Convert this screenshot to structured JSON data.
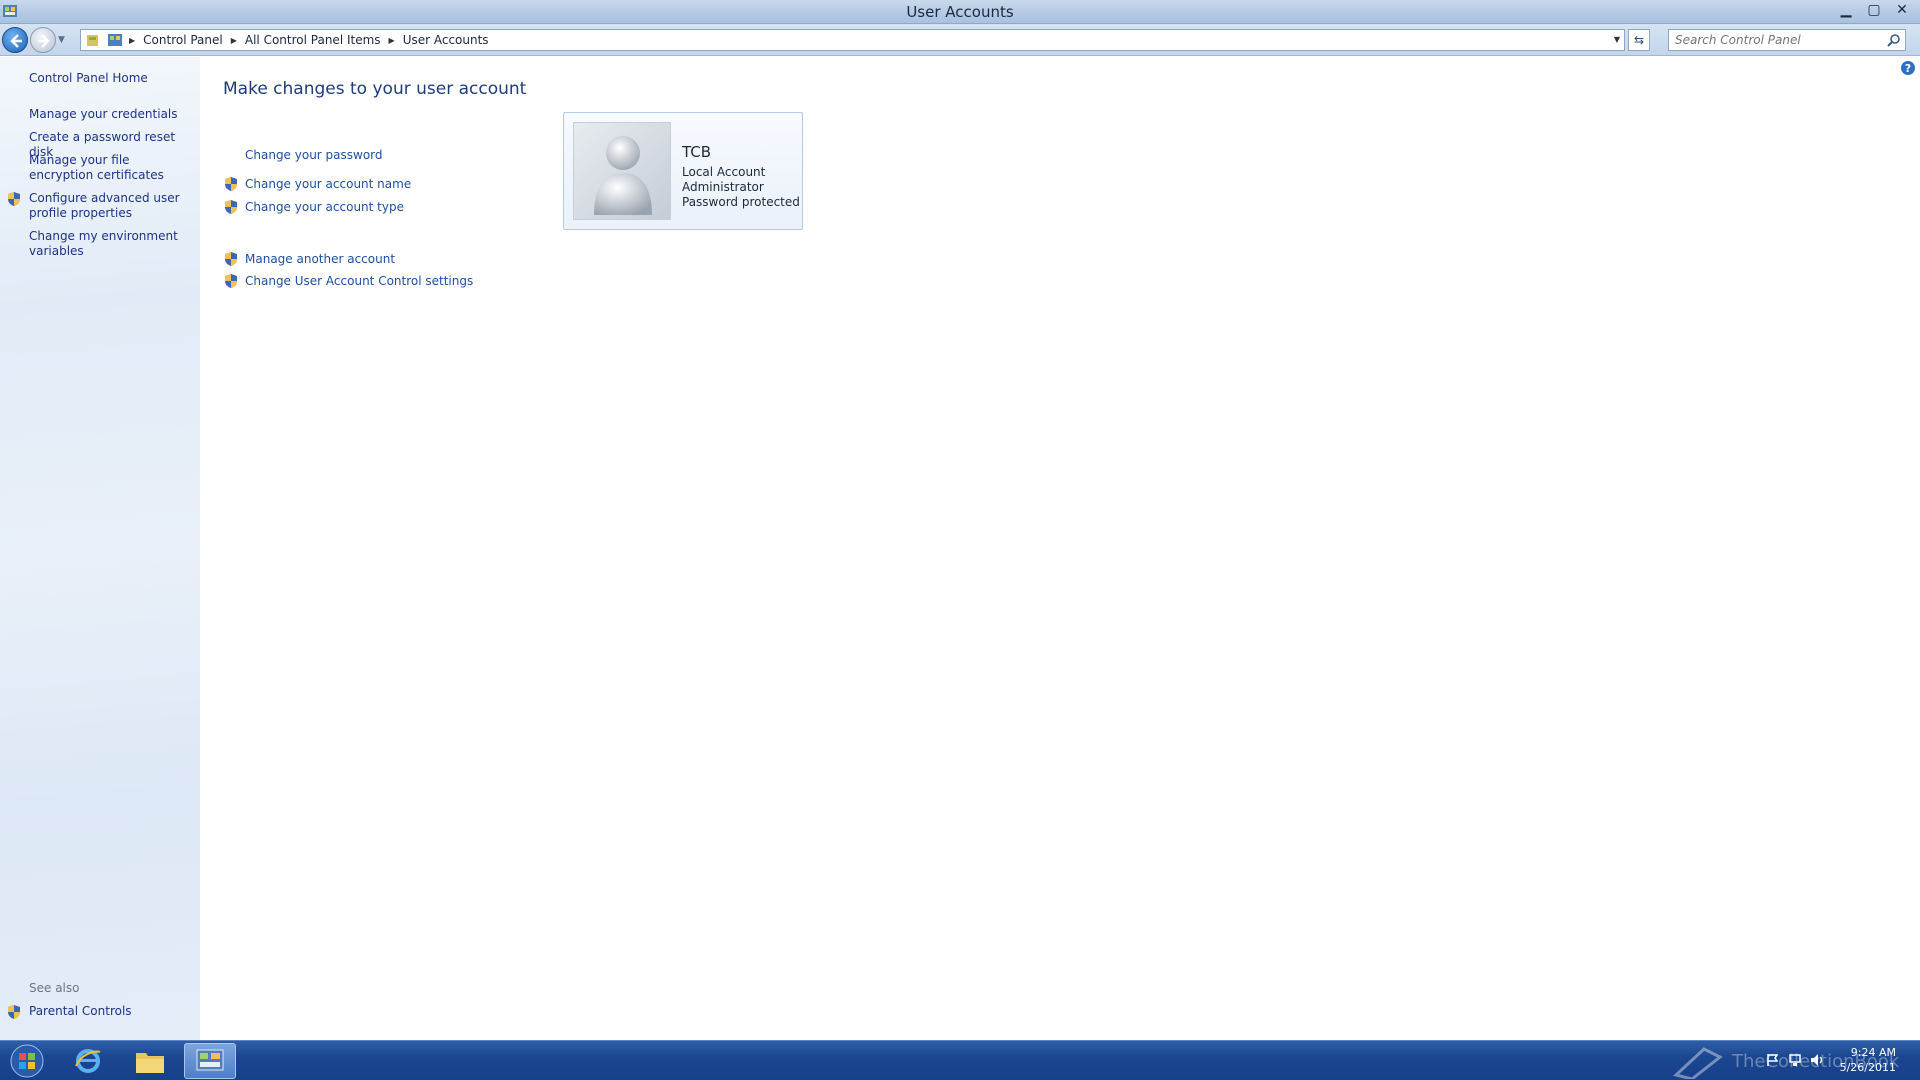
{
  "window": {
    "title": "User Accounts",
    "minimize_label": "▁",
    "maximize_label": "▢",
    "close_label": "✕"
  },
  "nav": {
    "breadcrumbs": [
      "Control Panel",
      "All Control Panel Items",
      "User Accounts"
    ],
    "search_placeholder": "Search Control Panel"
  },
  "sidebar": {
    "home": "Control Panel Home",
    "items": [
      {
        "label": "Manage your credentials",
        "shield": false
      },
      {
        "label": "Create a password reset disk",
        "shield": false
      },
      {
        "label": "Manage your file encryption certificates",
        "shield": false
      },
      {
        "label": "Configure advanced user profile properties",
        "shield": true
      },
      {
        "label": "Change my environment variables",
        "shield": false
      }
    ],
    "see_also_heading": "See also",
    "see_also_items": [
      {
        "label": "Parental Controls",
        "shield": true
      }
    ]
  },
  "main": {
    "title": "Make changes to your user account",
    "tasks_group1": [
      {
        "label": "Change your password",
        "shield": false
      },
      {
        "label": "Change your account name",
        "shield": true
      },
      {
        "label": "Change your account type",
        "shield": true
      }
    ],
    "tasks_group2": [
      {
        "label": "Manage another account",
        "shield": true
      },
      {
        "label": "Change User Account Control settings",
        "shield": true
      }
    ]
  },
  "account": {
    "name": "TCB",
    "type": "Local Account",
    "role": "Administrator",
    "status": "Password protected"
  },
  "taskbar": {
    "watermark": "TheCollectionBook",
    "time": "9:24 AM",
    "date": "5/26/2011"
  },
  "colors": {
    "link": "#1e50a0",
    "title": "#1e3d7d",
    "taskbar": "#1b4790"
  }
}
